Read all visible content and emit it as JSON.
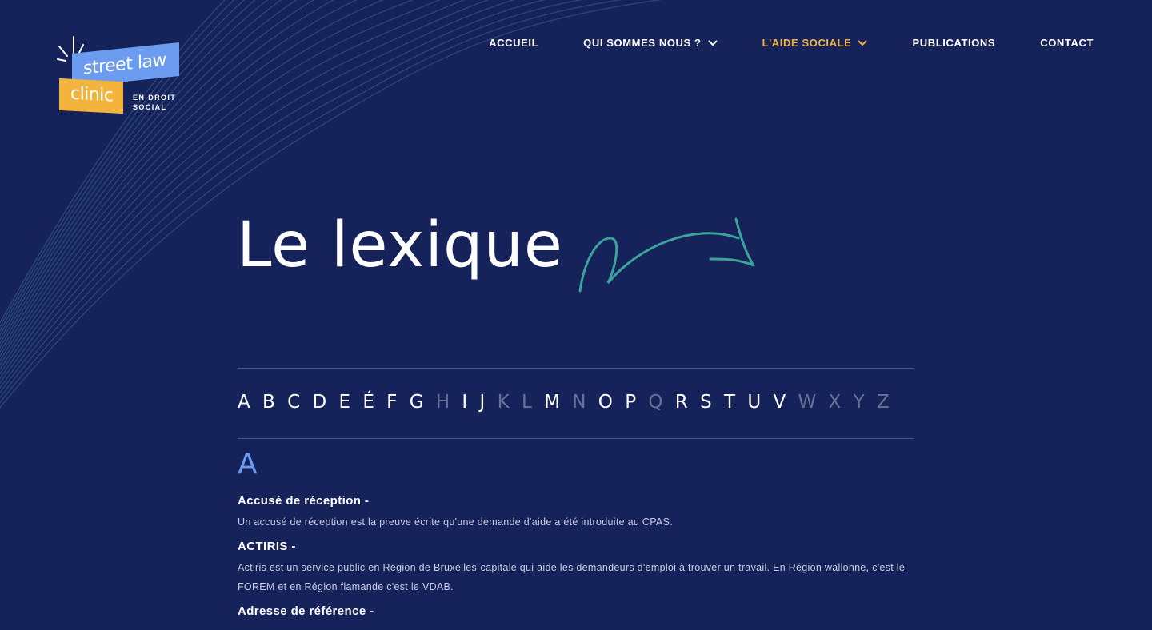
{
  "logo": {
    "line1": "street law",
    "line2": "clinic",
    "subtitle": "EN DROIT SOCIAL",
    "colors": {
      "blue": "#6c9cf0",
      "yellow": "#f2b43b"
    }
  },
  "nav": {
    "items": [
      {
        "label": "ACCUEIL",
        "dropdown": false,
        "active": false
      },
      {
        "label": "QUI SOMMES NOUS ?",
        "dropdown": true,
        "active": false
      },
      {
        "label": "L'AIDE SOCIALE",
        "dropdown": true,
        "active": true
      },
      {
        "label": "PUBLICATIONS",
        "dropdown": false,
        "active": false
      },
      {
        "label": "CONTACT",
        "dropdown": false,
        "active": false
      }
    ]
  },
  "hero": {
    "title": "Le lexique",
    "arrow_icon": "curved-arrow-icon"
  },
  "alphabet": [
    {
      "l": "A",
      "on": true
    },
    {
      "l": "B",
      "on": true
    },
    {
      "l": "C",
      "on": true
    },
    {
      "l": "D",
      "on": true
    },
    {
      "l": "E",
      "on": true
    },
    {
      "l": "É",
      "on": true
    },
    {
      "l": "F",
      "on": true
    },
    {
      "l": "G",
      "on": true
    },
    {
      "l": "H",
      "on": false
    },
    {
      "l": "I",
      "on": true
    },
    {
      "l": "J",
      "on": true
    },
    {
      "l": "K",
      "on": false
    },
    {
      "l": "L",
      "on": false
    },
    {
      "l": "M",
      "on": true
    },
    {
      "l": "N",
      "on": false
    },
    {
      "l": "O",
      "on": true
    },
    {
      "l": "P",
      "on": true
    },
    {
      "l": "Q",
      "on": false
    },
    {
      "l": "R",
      "on": true
    },
    {
      "l": "S",
      "on": true
    },
    {
      "l": "T",
      "on": true
    },
    {
      "l": "U",
      "on": true
    },
    {
      "l": "V",
      "on": true
    },
    {
      "l": "W",
      "on": false
    },
    {
      "l": "X",
      "on": false
    },
    {
      "l": "Y",
      "on": false
    },
    {
      "l": "Z",
      "on": false
    }
  ],
  "section": {
    "letter": "A",
    "entries": [
      {
        "term": "Accusé de réception -",
        "definition": "Un accusé de réception est la preuve écrite qu'une demande d'aide a été introduite au CPAS."
      },
      {
        "term": "ACTIRIS -",
        "definition": "Actiris est un service public en Région de Bruxelles-capitale qui aide les demandeurs d'emploi à trouver un travail. En Région wallonne, c'est le FOREM et en Région flamande c'est le VDAB."
      },
      {
        "term": "Adresse de référence -",
        "definition": ""
      }
    ]
  },
  "colors": {
    "background": "#16225a",
    "accent": "#f2b43b",
    "letter_accent": "#6c9cf0",
    "arrow": "#3aa39a"
  }
}
